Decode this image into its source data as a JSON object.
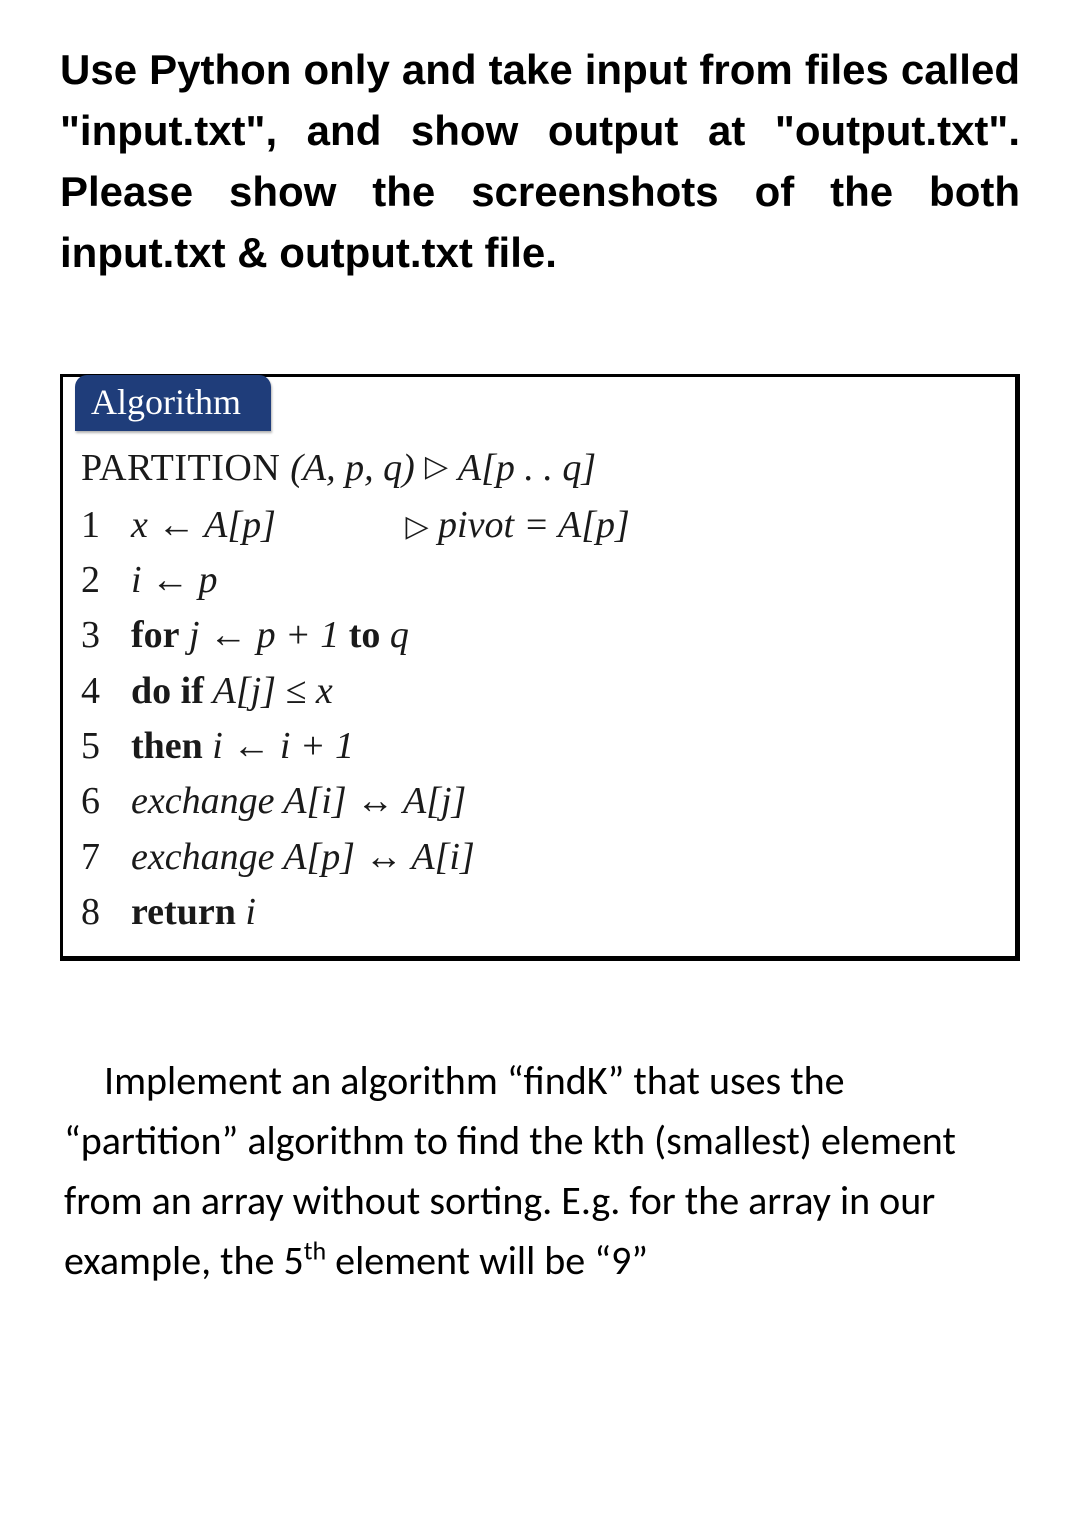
{
  "instructions": "Use Python only and take input from files called \"input.txt\", and show output at \"output.txt\". Please show the screenshots of the both input.txt & output.txt file.",
  "algorithm": {
    "header": "Algorithm",
    "title_fn": "PARTITION",
    "title_args": "(A, p, q)",
    "title_rhs": "A[p . . q]",
    "pivot_comment": "pivot = A[p]",
    "lines": {
      "l1_lhs": "x ← A[p]",
      "l2": "i ← p",
      "l3_for": "for",
      "l3_body": " j ← p + 1 ",
      "l3_to": "to",
      "l3_end": " q",
      "l4_doif": "do if",
      "l4_cond": " A[j] ≤ x",
      "l5_then": "then",
      "l5_body": " i ← i + 1",
      "l6": "exchange A[i] ↔ A[j]",
      "l7": "exchange A[p] ↔ A[i]",
      "l8_ret": "return",
      "l8_var": " i"
    },
    "numbers": {
      "n1": "1",
      "n2": "2",
      "n3": "3",
      "n4": "4",
      "n5": "5",
      "n6": "6",
      "n7": "7",
      "n8": "8"
    }
  },
  "question": {
    "p1": "Implement an algorithm “findK” that uses the “partition” algorithm to find the kth (smallest) element from an array without sorting. E.g. for the array in our example, the 5",
    "sup": "th",
    "p2": " element will be “9”"
  }
}
